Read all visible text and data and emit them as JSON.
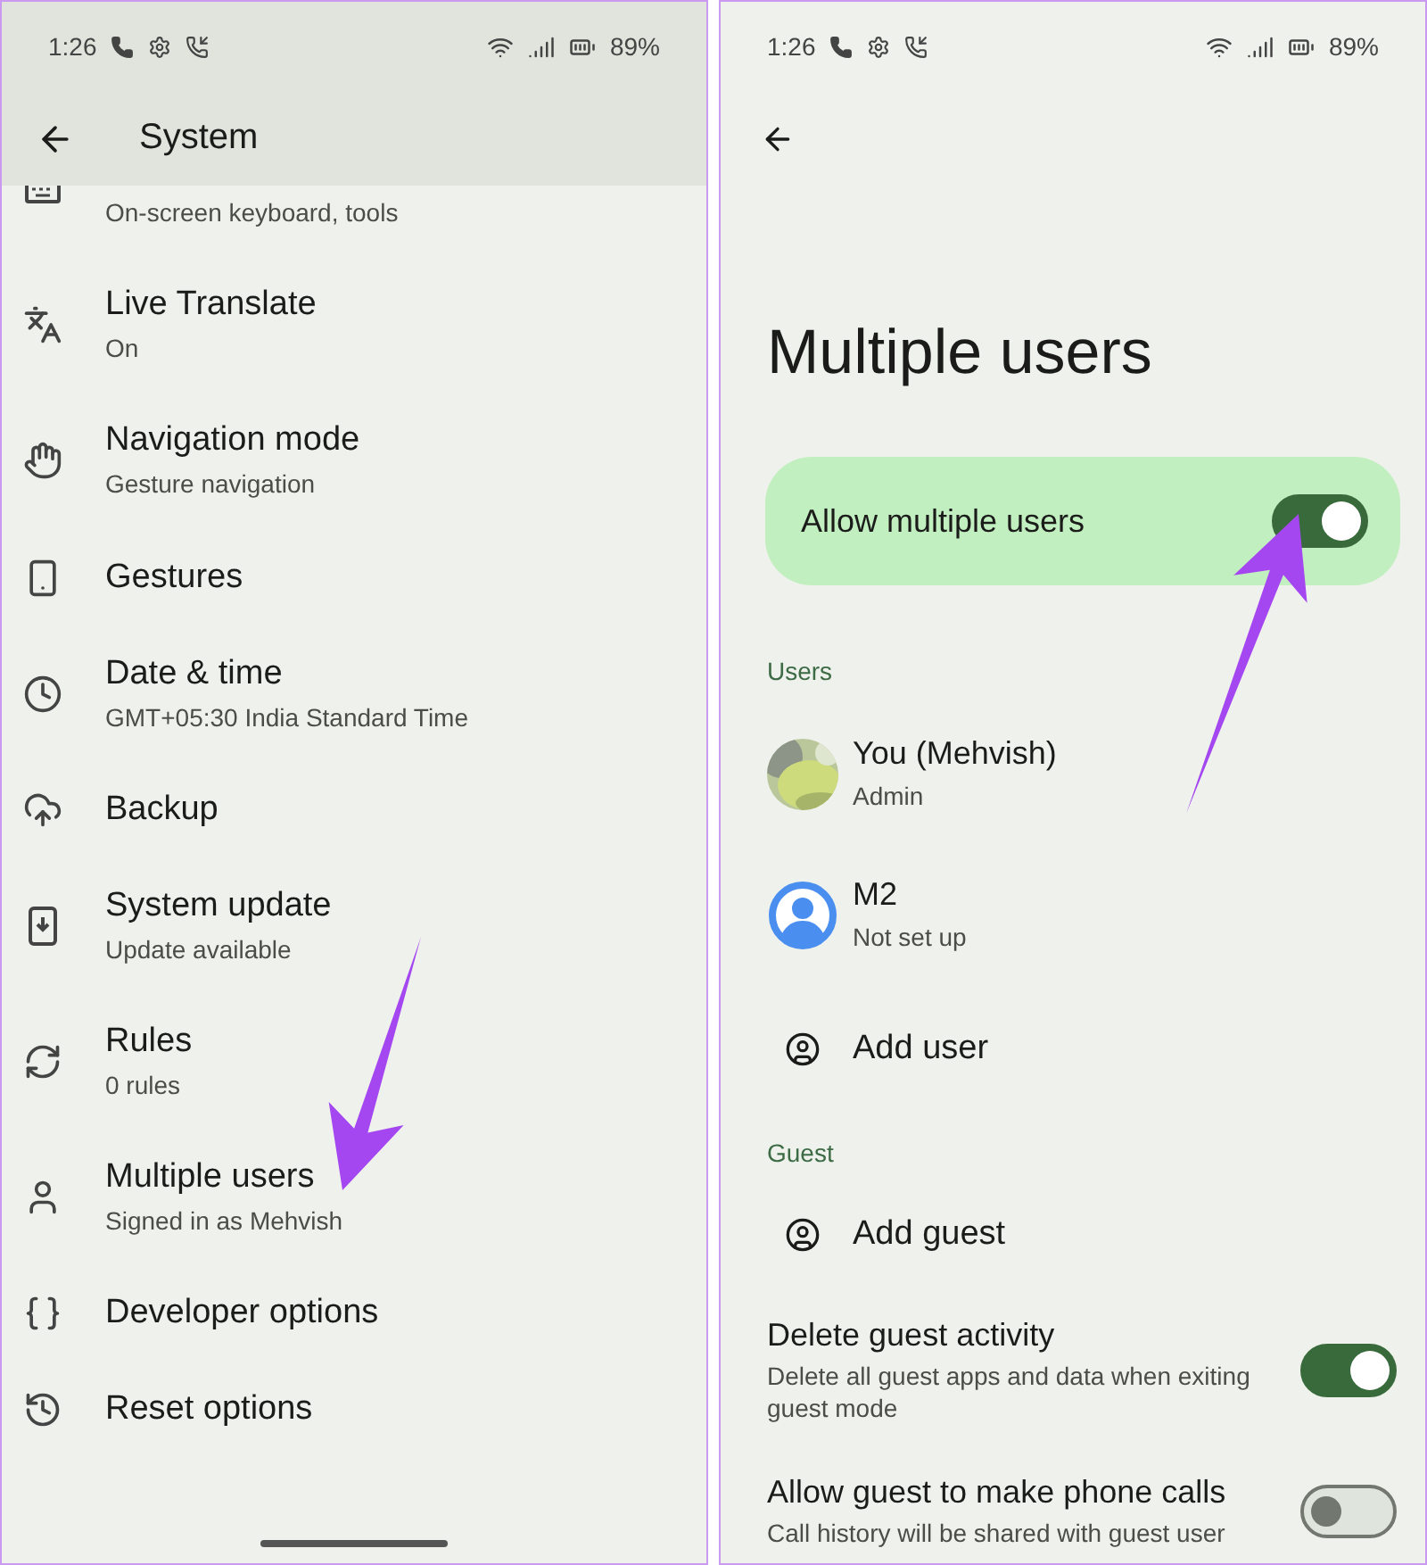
{
  "left_screen": {
    "status_bar": {
      "time": "1:26",
      "battery": "89%"
    },
    "header": {
      "title": "System"
    },
    "items": [
      {
        "subtitle": "On-screen keyboard, tools"
      },
      {
        "title": "Live Translate",
        "subtitle": "On"
      },
      {
        "title": "Navigation mode",
        "subtitle": "Gesture navigation"
      },
      {
        "title": "Gestures"
      },
      {
        "title": "Date & time",
        "subtitle": "GMT+05:30 India Standard Time"
      },
      {
        "title": "Backup"
      },
      {
        "title": "System update",
        "subtitle": "Update available"
      },
      {
        "title": "Rules",
        "subtitle": "0 rules"
      },
      {
        "title": "Multiple users",
        "subtitle": "Signed in as Mehvish"
      },
      {
        "title": "Developer options"
      },
      {
        "title": "Reset options"
      }
    ]
  },
  "right_screen": {
    "status_bar": {
      "time": "1:26",
      "battery": "89%"
    },
    "title": "Multiple users",
    "main_toggle": {
      "label": "Allow multiple users",
      "on": true
    },
    "users_section": {
      "heading": "Users",
      "users": [
        {
          "name": "You (Mehvish)",
          "role": "Admin"
        },
        {
          "kind": "placeholder",
          "name": "M2",
          "role": "Not set up"
        }
      ],
      "add_label": "Add user"
    },
    "guest_section": {
      "heading": "Guest",
      "add_label": "Add guest"
    },
    "settings": [
      {
        "title": "Delete guest activity",
        "subtitle": "Delete all guest apps and data when exiting guest mode",
        "on": true
      },
      {
        "title": "Allow guest to make phone calls",
        "subtitle": "Call history will be shared with guest user",
        "on": false
      }
    ]
  }
}
